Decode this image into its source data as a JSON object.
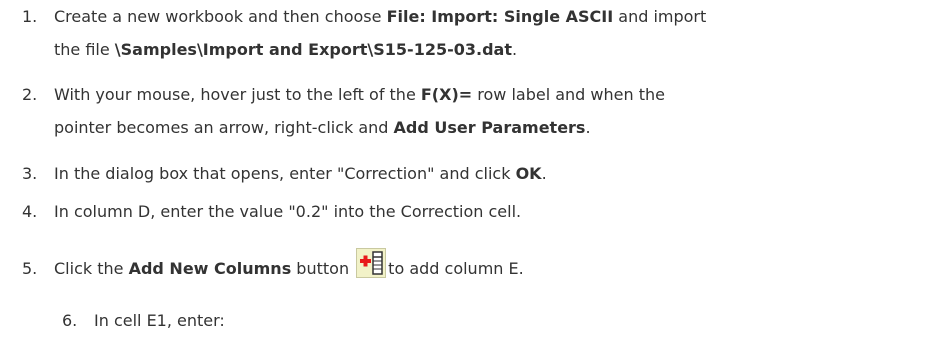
{
  "steps": [
    {
      "num": "1.",
      "t1": "Create a new workbook and then choose ",
      "b1": "File: Import: Single ASCII",
      "t2": " and import",
      "t3": "the file ",
      "b2": "\\Samples\\Import and Export\\S15-125-03.dat",
      "t4": "."
    },
    {
      "num": "2.",
      "t1": "With your mouse, hover just to the left of the ",
      "b1": "F(X)=",
      "t2": " row label and when the",
      "t3": "pointer becomes an arrow, right-click and ",
      "b2": "Add User Parameters",
      "t4": "."
    },
    {
      "num": "3.",
      "t1": "In the dialog box that opens, enter \"Correction\" and click ",
      "b1": "OK",
      "t2": "."
    },
    {
      "num": "4.",
      "t1": "In column D, enter the value \"0.2\" into the Correction cell."
    },
    {
      "num": "5.",
      "t1": "Click the ",
      "b1": "Add New Columns",
      "t2": " button ",
      "t3": "to add column E."
    },
    {
      "num": "6.",
      "t1": "In cell E1, enter:"
    }
  ],
  "icons": {
    "add_columns": "add-new-columns-icon"
  },
  "colors": {
    "text": "#333333",
    "icon_plus": "#e8191b",
    "icon_bg": "#f2f2c8"
  }
}
